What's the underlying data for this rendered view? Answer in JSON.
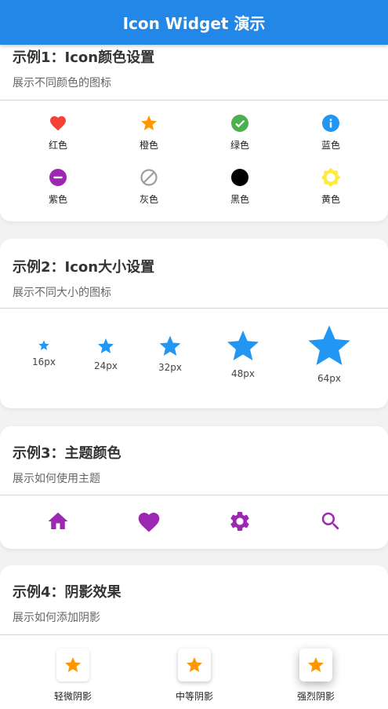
{
  "appbar": {
    "title": "Icon Widget 演示"
  },
  "example1": {
    "title": "示例1：Icon颜色设置",
    "subtitle": "展示不同颜色的图标",
    "items": [
      {
        "label": "红色",
        "icon": "heart-icon",
        "color": "#f44336"
      },
      {
        "label": "橙色",
        "icon": "star-icon",
        "color": "#ff9800"
      },
      {
        "label": "绿色",
        "icon": "check-circle-icon",
        "color": "#4caf50"
      },
      {
        "label": "蓝色",
        "icon": "info-icon",
        "color": "#2196f3"
      },
      {
        "label": "紫色",
        "icon": "remove-circle-icon",
        "color": "#9c27b0"
      },
      {
        "label": "灰色",
        "icon": "block-icon",
        "color": "#9e9e9e"
      },
      {
        "label": "黑色",
        "icon": "circle-icon",
        "color": "#000000"
      },
      {
        "label": "黄色",
        "icon": "sun-icon",
        "color": "#ffeb3b"
      }
    ]
  },
  "example2": {
    "title": "示例2：Icon大小设置",
    "subtitle": "展示不同大小的图标",
    "items": [
      {
        "label": "16px",
        "size": 16
      },
      {
        "label": "24px",
        "size": 24
      },
      {
        "label": "32px",
        "size": 32
      },
      {
        "label": "48px",
        "size": 48
      },
      {
        "label": "64px",
        "size": 64
      }
    ],
    "color": "#2196f3"
  },
  "example3": {
    "title": "示例3：主题颜色",
    "subtitle": "展示如何使用主题",
    "icons": [
      "home-icon",
      "heart-icon",
      "settings-icon",
      "search-icon"
    ],
    "color": "#9c27b0"
  },
  "example4": {
    "title": "示例4：阴影效果",
    "subtitle": "展示如何添加阴影",
    "items": [
      {
        "label": "轻微阴影",
        "icon": "star-icon"
      },
      {
        "label": "中等阴影",
        "icon": "star-icon"
      },
      {
        "label": "强烈阴影",
        "icon": "star-icon"
      }
    ],
    "color": "#ff9800"
  }
}
